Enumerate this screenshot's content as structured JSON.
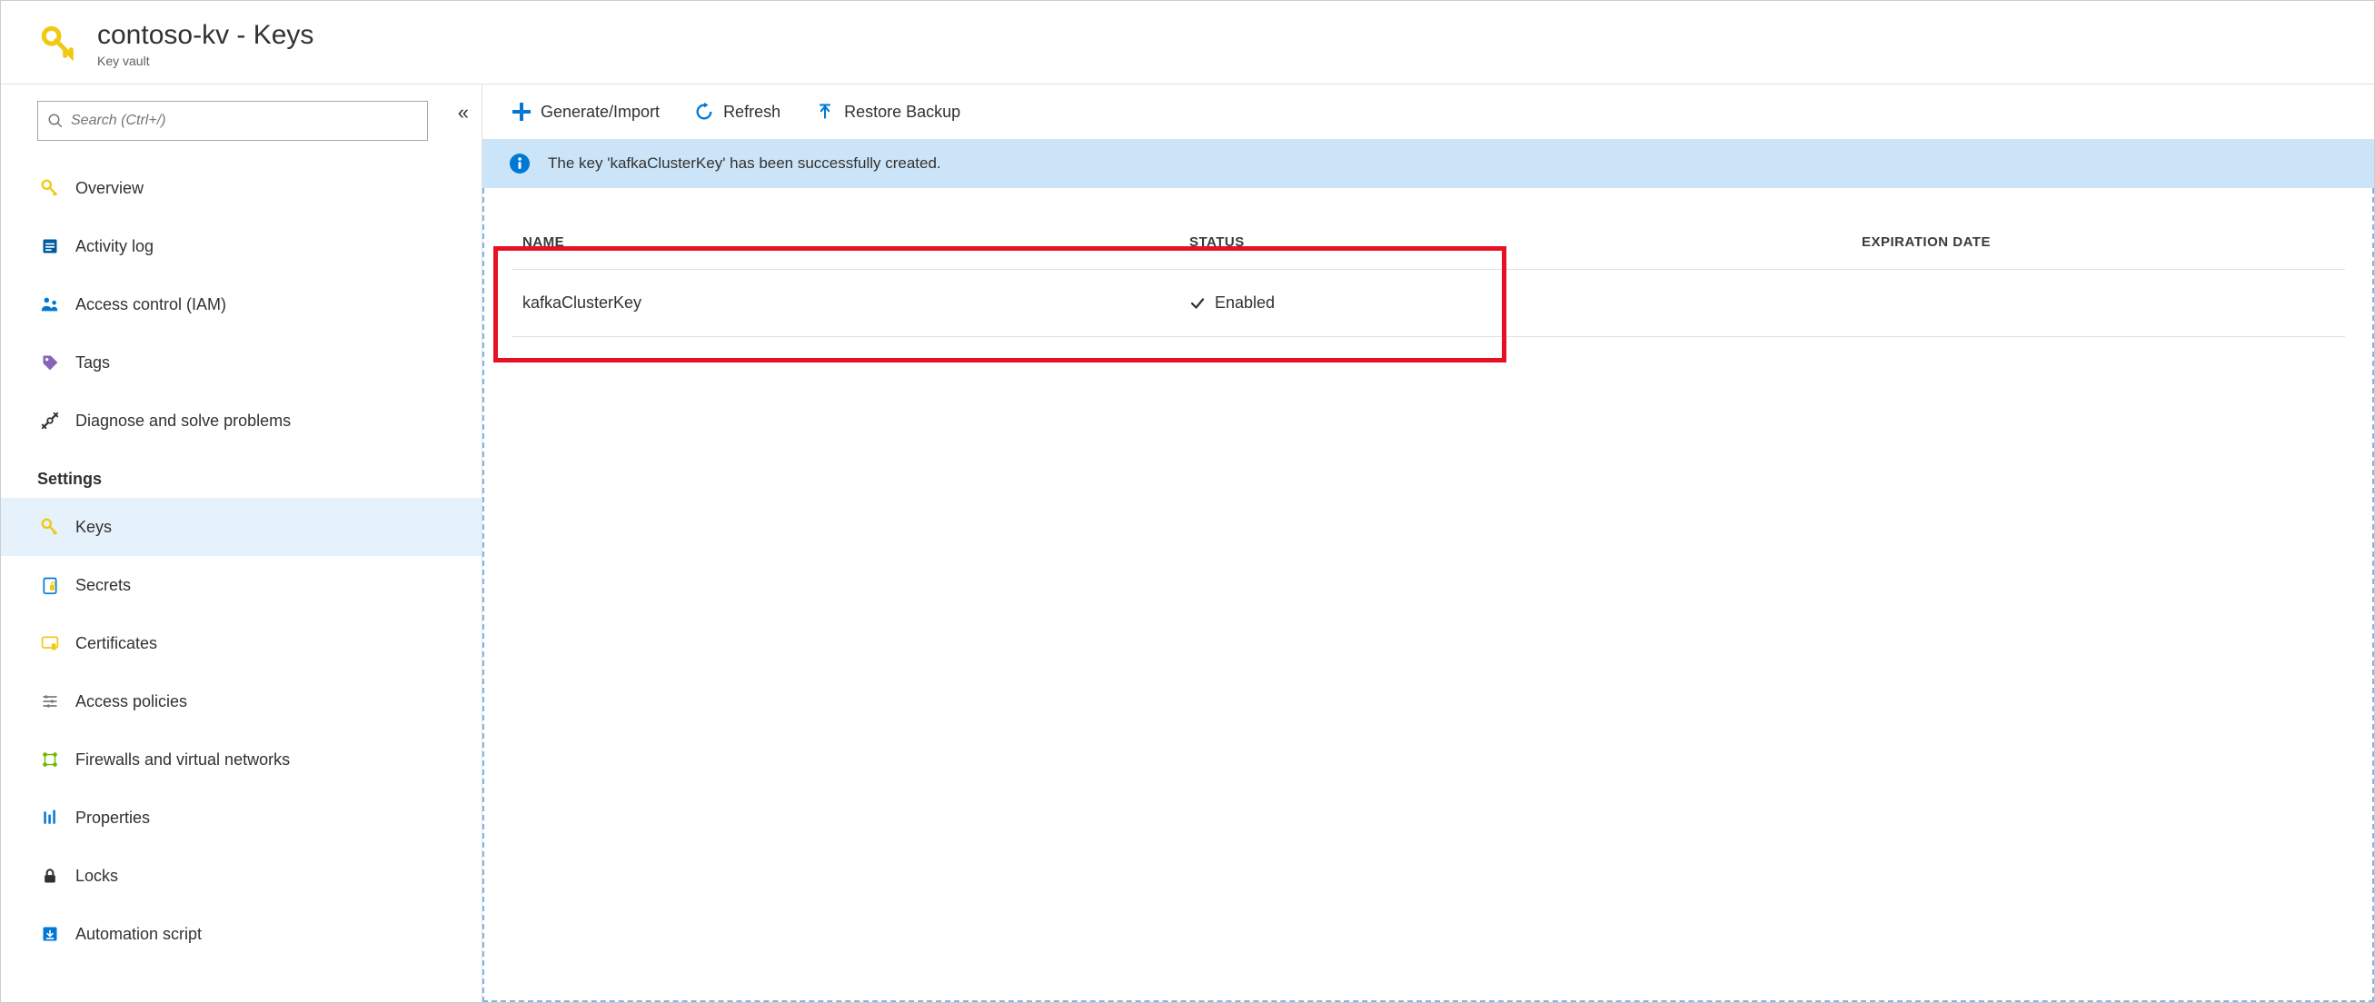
{
  "header": {
    "title": "contoso-kv - Keys",
    "subtitle": "Key vault"
  },
  "sidebar": {
    "search_placeholder": "Search (Ctrl+/)",
    "section_settings": "Settings",
    "items": {
      "overview": "Overview",
      "activity_log": "Activity log",
      "iam": "Access control (IAM)",
      "tags": "Tags",
      "diagnose": "Diagnose and solve problems",
      "keys": "Keys",
      "secrets": "Secrets",
      "certificates": "Certificates",
      "access_policies": "Access policies",
      "firewalls": "Firewalls and virtual networks",
      "properties": "Properties",
      "locks": "Locks",
      "automation": "Automation script"
    }
  },
  "toolbar": {
    "generate_import": "Generate/Import",
    "refresh": "Refresh",
    "restore_backup": "Restore Backup"
  },
  "notification": {
    "message": "The key 'kafkaClusterKey' has been successfully created."
  },
  "table": {
    "headers": {
      "name": "NAME",
      "status": "STATUS",
      "expiration": "EXPIRATION DATE"
    },
    "rows": [
      {
        "name": "kafkaClusterKey",
        "status": "Enabled",
        "expiration": ""
      }
    ]
  }
}
